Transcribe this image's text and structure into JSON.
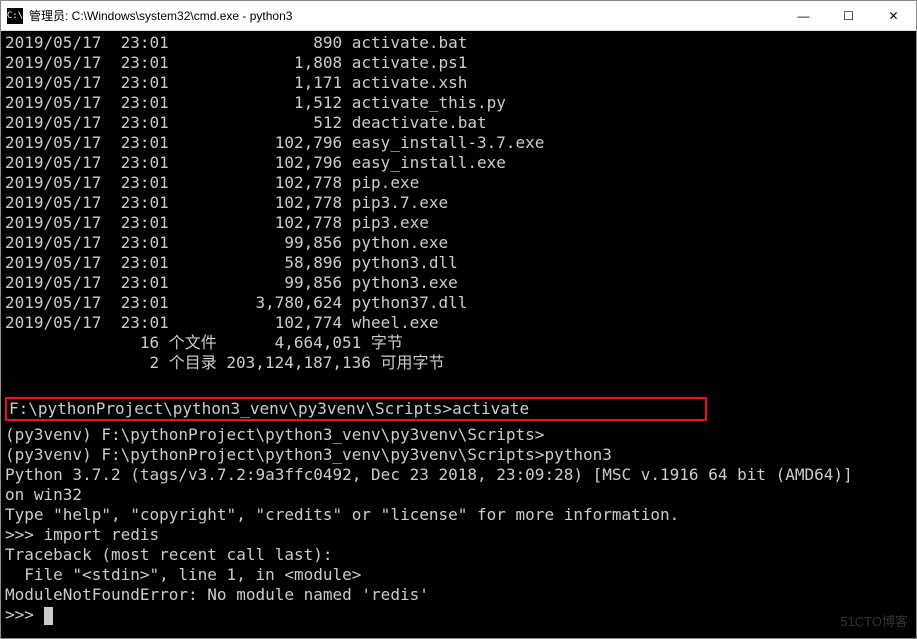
{
  "window": {
    "title": "管理员: C:\\Windows\\system32\\cmd.exe - python3",
    "icon_label": "C:\\"
  },
  "files": [
    {
      "date": "2019/05/17",
      "time": "23:01",
      "size": "890",
      "name": "activate.bat"
    },
    {
      "date": "2019/05/17",
      "time": "23:01",
      "size": "1,808",
      "name": "activate.ps1"
    },
    {
      "date": "2019/05/17",
      "time": "23:01",
      "size": "1,171",
      "name": "activate.xsh"
    },
    {
      "date": "2019/05/17",
      "time": "23:01",
      "size": "1,512",
      "name": "activate_this.py"
    },
    {
      "date": "2019/05/17",
      "time": "23:01",
      "size": "512",
      "name": "deactivate.bat"
    },
    {
      "date": "2019/05/17",
      "time": "23:01",
      "size": "102,796",
      "name": "easy_install-3.7.exe"
    },
    {
      "date": "2019/05/17",
      "time": "23:01",
      "size": "102,796",
      "name": "easy_install.exe"
    },
    {
      "date": "2019/05/17",
      "time": "23:01",
      "size": "102,778",
      "name": "pip.exe"
    },
    {
      "date": "2019/05/17",
      "time": "23:01",
      "size": "102,778",
      "name": "pip3.7.exe"
    },
    {
      "date": "2019/05/17",
      "time": "23:01",
      "size": "102,778",
      "name": "pip3.exe"
    },
    {
      "date": "2019/05/17",
      "time": "23:01",
      "size": "99,856",
      "name": "python.exe"
    },
    {
      "date": "2019/05/17",
      "time": "23:01",
      "size": "58,896",
      "name": "python3.dll"
    },
    {
      "date": "2019/05/17",
      "time": "23:01",
      "size": "99,856",
      "name": "python3.exe"
    },
    {
      "date": "2019/05/17",
      "time": "23:01",
      "size": "3,780,624",
      "name": "python37.dll"
    },
    {
      "date": "2019/05/17",
      "time": "23:01",
      "size": "102,774",
      "name": "wheel.exe"
    }
  ],
  "summary": {
    "files_line": "              16 个文件      4,664,051 字节",
    "dirs_line": "               2 个目录 203,124,187,136 可用字节"
  },
  "prompt1": {
    "path": "F:\\pythonProject\\python3_venv\\py3venv\\Scripts>",
    "command": "activate"
  },
  "prompt2": {
    "prefix": "(py3venv) ",
    "path": "F:\\pythonProject\\python3_venv\\py3venv\\Scripts>"
  },
  "prompt3": {
    "prefix": "(py3venv) ",
    "path": "F:\\pythonProject\\python3_venv\\py3venv\\Scripts>",
    "command": "python3"
  },
  "python": {
    "banner1": "Python 3.7.2 (tags/v3.7.2:9a3ffc0492, Dec 23 2018, 23:09:28) [MSC v.1916 64 bit (AMD64)]",
    "banner2": "on win32",
    "help": "Type \"help\", \"copyright\", \"credits\" or \"license\" for more information.",
    "ps1": ">>> ",
    "input1": "import redis",
    "traceback1": "Traceback (most recent call last):",
    "traceback2": "  File \"<stdin>\", line 1, in <module>",
    "error": "ModuleNotFoundError: No module named 'redis'"
  },
  "watermark": "51CTO博客"
}
